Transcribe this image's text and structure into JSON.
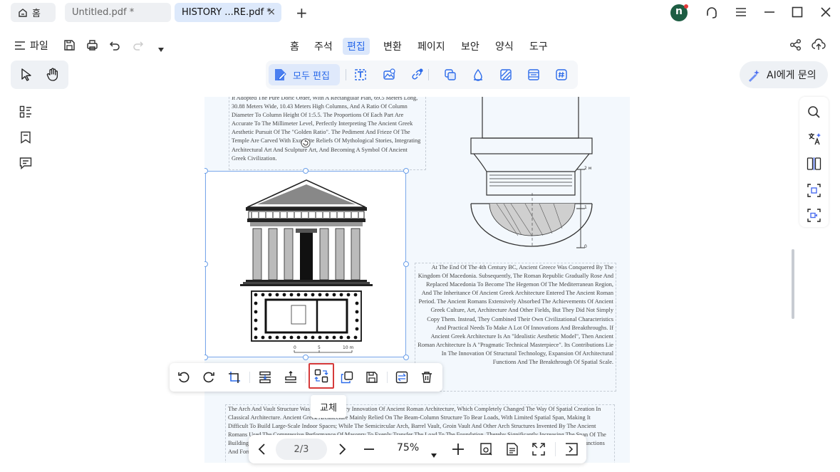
{
  "tabs": {
    "home_label": "홈",
    "untitled_label": "Untitled.pdf *",
    "history_label": "HISTORY ...RE.pdf *",
    "close_symbol": "×",
    "add_symbol": "+"
  },
  "avatar": {
    "initial": "n",
    "color": "#1d5d43"
  },
  "menu": {
    "file_label": "파일",
    "items": [
      "홈",
      "주석",
      "편집",
      "변환",
      "페이지",
      "보안",
      "양식",
      "도구"
    ],
    "active_index": 2
  },
  "toolbar": {
    "edit_all_label": "모두 편집",
    "ai_label": "AI에게 문의"
  },
  "document": {
    "para_top": "It Adopted The Pure Doric Order, With A Rectangular Plan, 69.5 Meters Long, 30.88 Meters Wide, 10.43 Meters High Columns, And A Ratio Of Column Diameter To Column Height Of 1:5.5. The Proportions Of Each Part Are Accurate To The Millimeter Level, Perfectly Interpreting The Ancient Greek Aesthetic Pursuit Of The \"Golden Ratio\". The Pediment And Frieze Of The Temple Are Carved With Exquisite Reliefs Of Mythological Stories, Integrating Architectural Art And Sculpture Art, And Becoming A Symbol Of Ancient Greek Civilization.",
    "para_right": "At The End Of The 4th Century BC, Ancient Greece Was Conquered By The Kingdom Of Macedonia. Subsequently, The Roman Republic Gradually Rose And Replaced Macedonia To Become The Hegemon Of The Mediterranean Region, And The Inheritance Of Ancient Greek Architecture Entered The Ancient Roman Period. The Ancient Romans Extensively Absorbed The Achievements Of Ancient Greek Culture, Art, Architecture And Other Fields, But They Did Not Simply Copy Them. Instead, They Combined Their Own Civilizational Characteristics And Practical Needs To Make A Lot Of Innovations And Breakthroughs. If Ancient Greek Architecture Is An \"Idealistic Aesthetic Model\", Then Ancient Roman Architecture Is A \"Pragmatic Technical Masterpiece\". Its Contributions Lie In The Innovation Of Structural Technology, Expansion Of Architectural Functions And The Breakthrough Of Spatial Scale.",
    "para_bottom": "The Arch And Vault Structure Was A Revolutionary Innovation Of Ancient Roman Architecture, Which Completely Changed The Way Of Spatial Creation In Classical Architecture. Ancient Greek Architecture Mainly Relied On The Beam-Column Structure To Bear Loads, With Limited Spatial Span, Making It Difficult To Build Large-Scale Indoor Spaces; While The Semicircular Arch, Barrel Vault, Groin Vault And Other Arch Structures Invented By The Ancient Romans Used The Compressive Performance Of Masonry To Evenly Transfer The Load To The Foundation, Thereby Significantly Increasing The Span Of The Building Space. The Pantheon And The Baths Of Caracalla Are Typical Examples, Showing The Great Achievements Of Roman Architecture In The Functions And Forms Of Interior Space, And Laying The Foundation For Later Architectural Development And Its Multiple Paths.",
    "scale_labels": [
      "0",
      "5",
      "10 m"
    ],
    "column_scale_labels": [
      "2 м",
      "1",
      "0"
    ]
  },
  "image_toolbar": {
    "tooltip": "교체"
  },
  "bottom_nav": {
    "page_indicator": "2/3",
    "zoom_label": "75%"
  }
}
